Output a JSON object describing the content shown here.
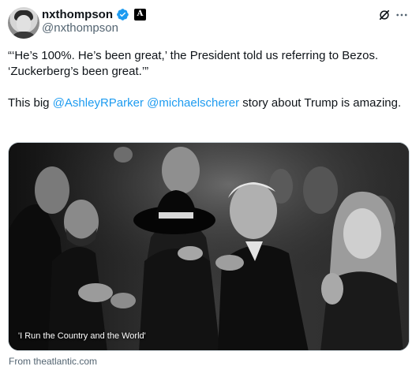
{
  "author": {
    "display_name": "nxthompson",
    "handle": "@nxthompson"
  },
  "tweet": {
    "paragraph1": "“‘He’s 100%. He’s been great,’ the President told us referring to Bezos. ‘Zuckerberg’s been great.’”",
    "p2_before": "This big ",
    "mention1": "@AshleyRParker",
    "p2_space": " ",
    "mention2": "@michaelscherer",
    "p2_after": " story about Trump is amazing."
  },
  "card": {
    "caption": "'I Run the Country and the World'",
    "source": "From theatlantic.com"
  },
  "icons": {
    "verified": "verified-badge-icon",
    "affiliation": "x-affiliation-badge-icon",
    "grok": "grok-icon",
    "more": "more-options-icon"
  },
  "colors": {
    "link": "#1d9bf0",
    "verified": "#1d9bf0",
    "secondary_text": "#536471"
  }
}
